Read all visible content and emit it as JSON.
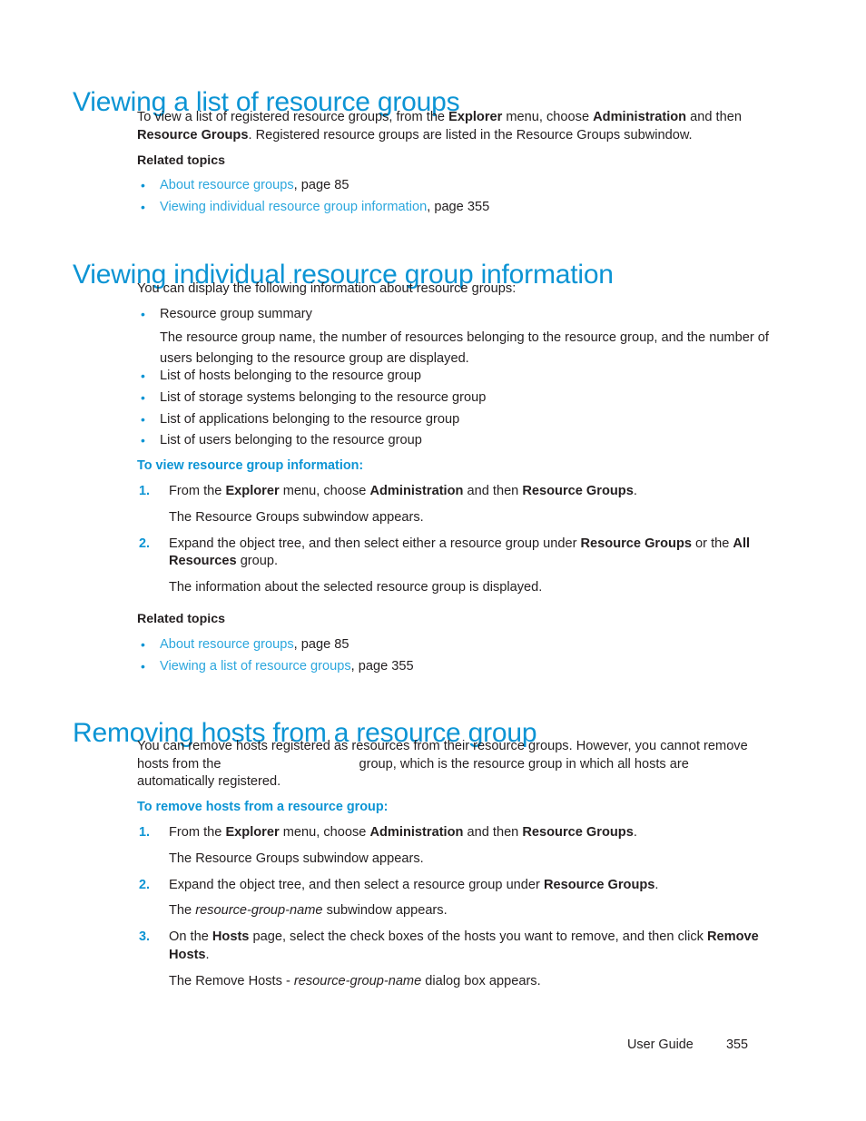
{
  "document": {
    "footer": {
      "guide_label": "User Guide",
      "page_number": "355"
    },
    "colors": {
      "heading_blue": "#0c94d4",
      "link_blue": "#2ba6dd",
      "body_black": "#231f20",
      "page_background": "#ffffff"
    }
  },
  "sections": [
    {
      "id": "viewing-a-list-of-resource-groups",
      "heading": "Viewing a list of resource groups",
      "intro": {
        "part1": "To view a list of registered resource groups, from the ",
        "bold1": "Explorer",
        "part2": " menu, choose ",
        "bold2": "Administration",
        "part3": " and then ",
        "bold3": "Resource Groups",
        "part4": ". Registered resource groups are listed in the Resource Groups subwindow."
      },
      "related_topics_label": "Related topics",
      "related_topics": [
        {
          "bullet": "•",
          "link": "About resource groups",
          "suffix": ", page 85"
        },
        {
          "bullet": "•",
          "link": "Viewing individual resource group information",
          "suffix": ", page 355"
        }
      ]
    },
    {
      "id": "viewing-individual-resource-group-information",
      "heading": "Viewing individual resource group information",
      "intro": "You can display the following information about resource groups:",
      "features": [
        {
          "bullet": "•",
          "text": "Resource group summary",
          "detail": "The resource group name, the number of resources belonging to the resource group, and the number of users belonging to the resource group are displayed."
        },
        {
          "bullet": "•",
          "text": "List of hosts belonging to the resource group"
        },
        {
          "bullet": "•",
          "text": "List of storage systems belonging to the resource group"
        },
        {
          "bullet": "•",
          "text": "List of applications belonging to the resource group"
        },
        {
          "bullet": "•",
          "text": "List of users belonging to the resource group"
        }
      ],
      "procedure_label": "To view resource group information:",
      "steps": [
        {
          "num": "1.",
          "part1": "From the ",
          "bold1": "Explorer",
          "part2": " menu, choose ",
          "bold2": "Administration",
          "part3": " and then ",
          "bold3": "Resource Groups",
          "part4": ".",
          "result": "The Resource Groups subwindow appears."
        },
        {
          "num": "2.",
          "part1": "Expand the object tree, and then select either a resource group under ",
          "bold1": "Resource Groups",
          "part2": " or the ",
          "bold2": "All Resources",
          "part3": " group.",
          "result": "The information about the selected resource group is displayed."
        }
      ],
      "related_topics_label": "Related topics",
      "related_topics": [
        {
          "bullet": "•",
          "link": "About resource groups",
          "suffix": ", page 85"
        },
        {
          "bullet": "•",
          "link": "Viewing a list of resource groups",
          "suffix": ", page 355"
        }
      ]
    },
    {
      "id": "removing-hosts-from-a-resource-group",
      "heading": "Removing hosts from a resource group",
      "intro": {
        "part1": "You can remove hosts registered as resources from their resource groups. However, you cannot remove hosts from the",
        "missing_variable": "",
        "part2": "group, which is the resource group in which all hosts are automatically registered."
      },
      "procedure_label": "To remove hosts from a resource group:",
      "steps": [
        {
          "num": "1.",
          "part1": "From the ",
          "bold1": "Explorer",
          "part2": " menu, choose ",
          "bold2": "Administration",
          "part3": " and then ",
          "bold3": "Resource Groups",
          "part4": ".",
          "result": "The Resource Groups subwindow appears."
        },
        {
          "num": "2.",
          "part1": "Expand the object tree, and then select a resource group under ",
          "bold1": "Resource Groups",
          "part2": ".",
          "result_part1": "The ",
          "result_italic": "resource-group-name",
          "result_part2": " subwindow appears."
        },
        {
          "num": "3.",
          "part1": "On the ",
          "bold1": "Hosts",
          "part2": " page, select the check boxes of the hosts you want to remove, and then click ",
          "bold2": "Remove Hosts",
          "part3": ".",
          "result_part1": "The Remove Hosts - ",
          "result_italic": "resource-group-name",
          "result_part2": " dialog box appears."
        }
      ]
    }
  ]
}
